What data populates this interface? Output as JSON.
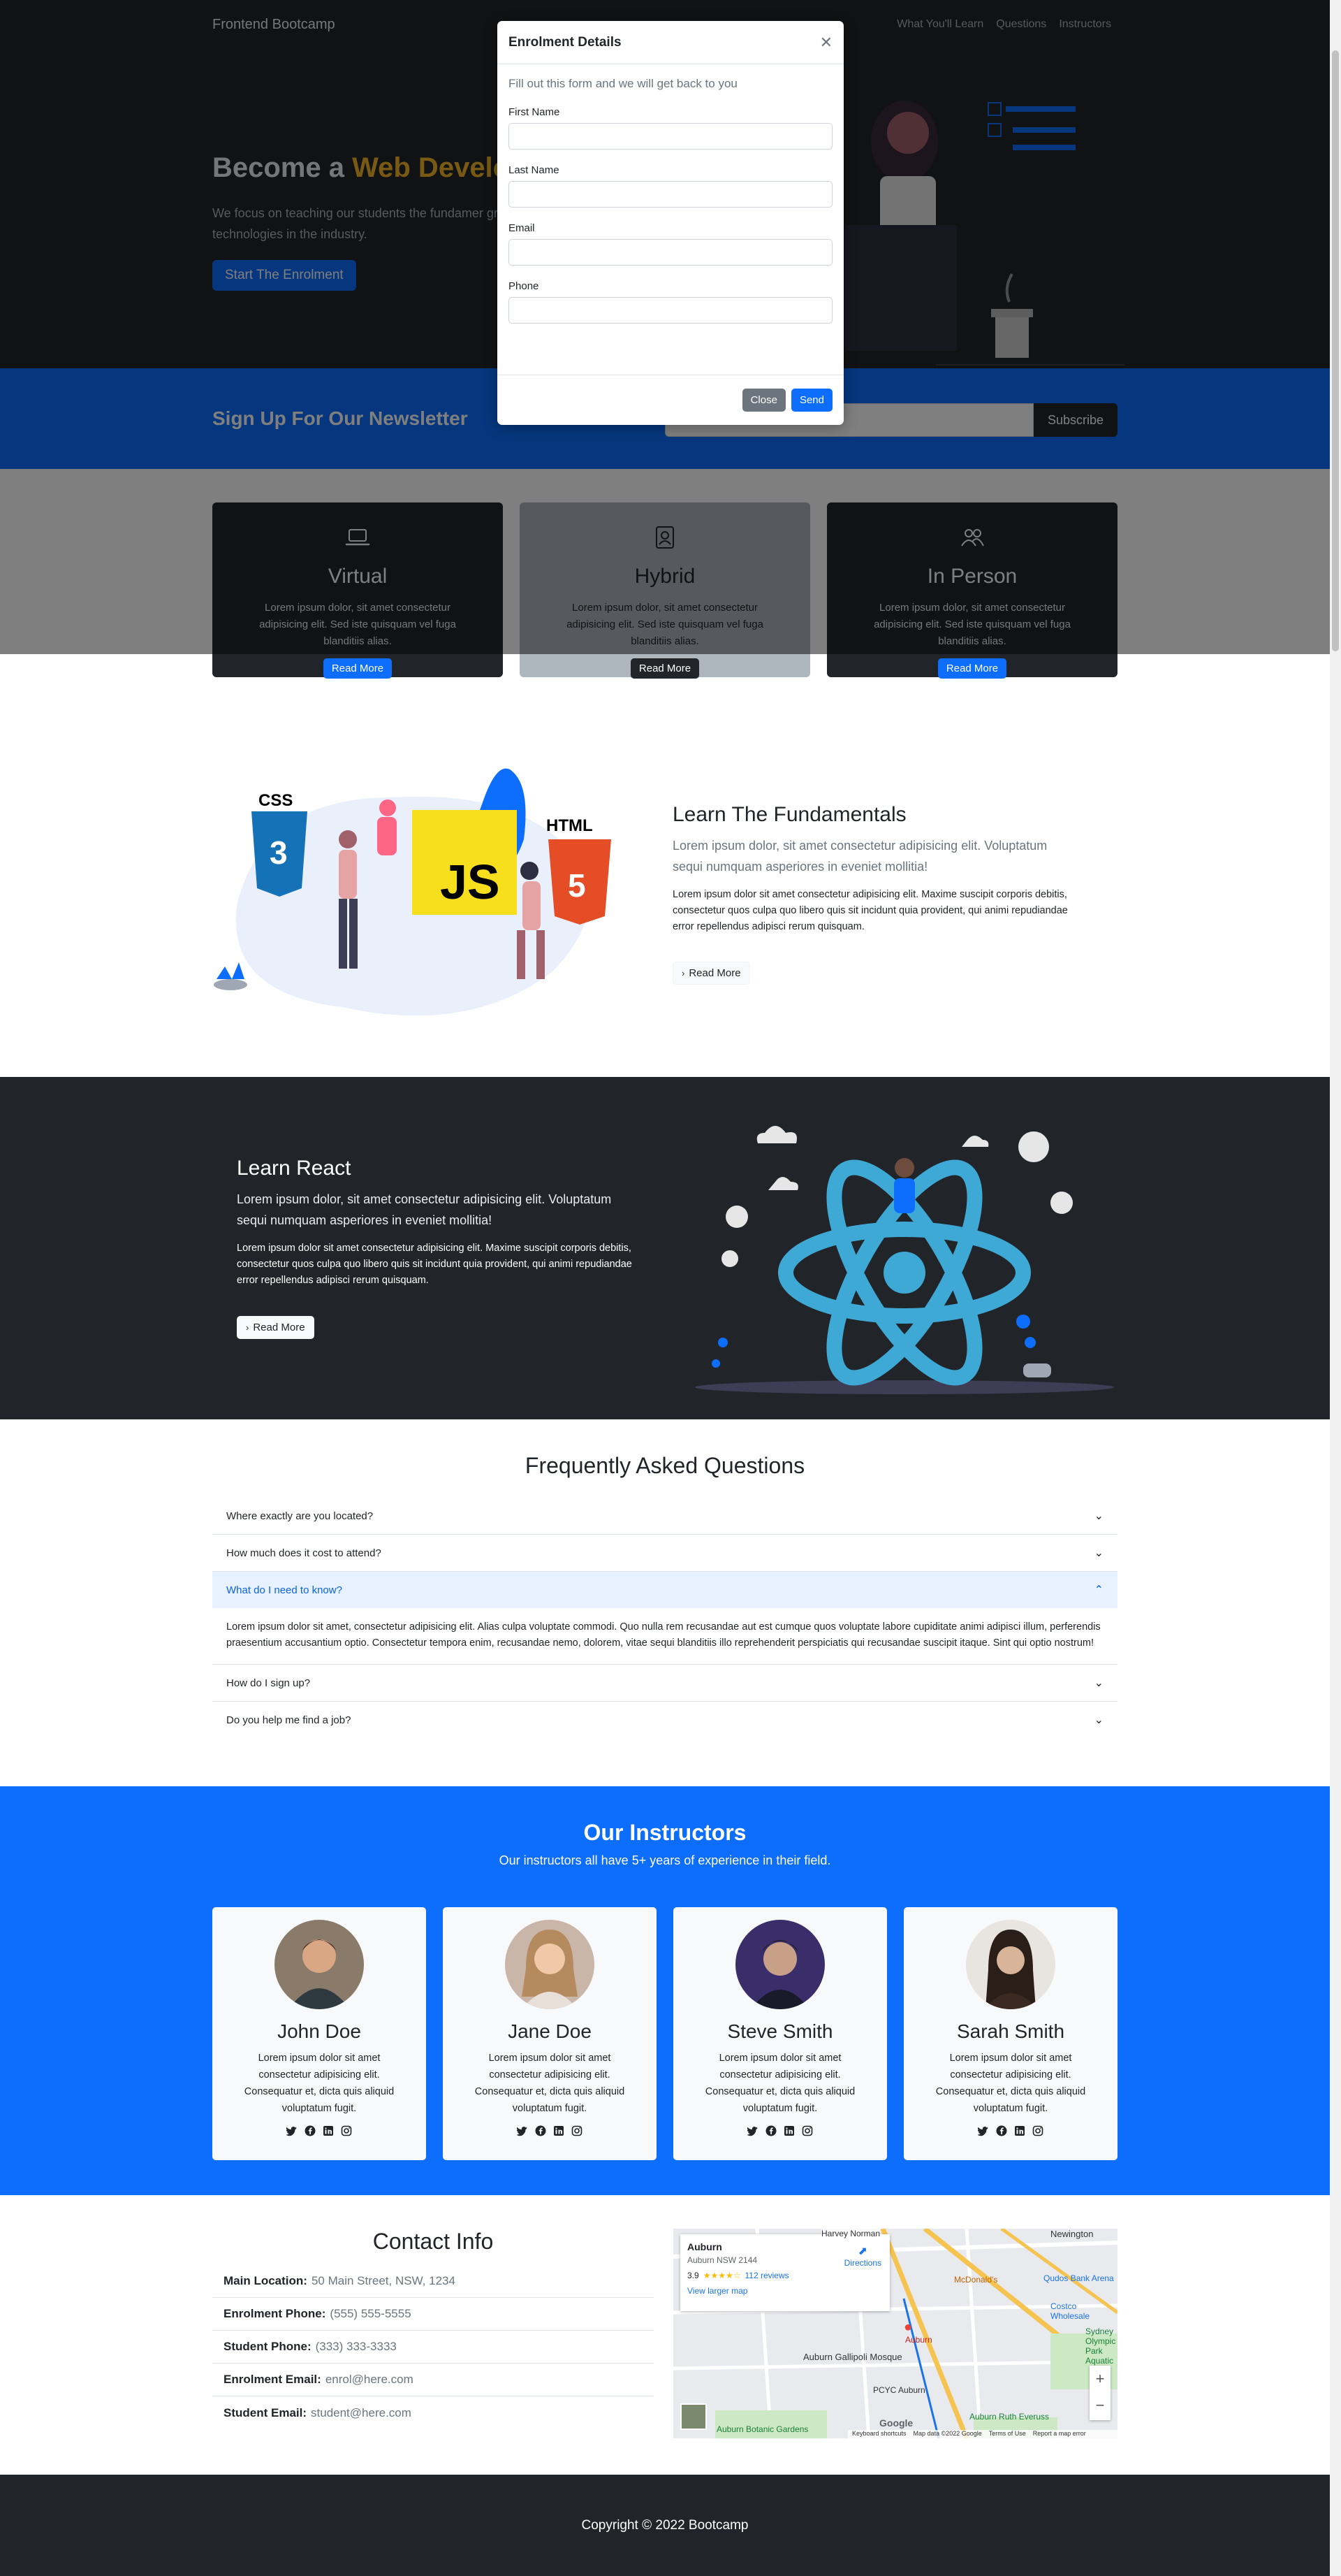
{
  "navbar": {
    "brand": "Frontend Bootcamp",
    "links": [
      "What You'll Learn",
      "Questions",
      "Instructors"
    ]
  },
  "hero": {
    "title_prefix": "Become a ",
    "title_accent": "Web Develo",
    "lead": "We focus on teaching our students the fundamer greatest technologies in the industry.",
    "button": "Start The Enrolment"
  },
  "newsletter": {
    "title": "Sign Up For Our Newsletter",
    "email_placeholder": "",
    "button": "Subscribe"
  },
  "boxes": [
    {
      "icon": "laptop-icon",
      "title": "Virtual",
      "text": "Lorem ipsum dolor, sit amet consectetur adipisicing elit. Sed iste quisquam vel fuga blanditiis alias.",
      "button": "Read More"
    },
    {
      "icon": "person-badge-icon",
      "title": "Hybrid",
      "text": "Lorem ipsum dolor, sit amet consectetur adipisicing elit. Sed iste quisquam vel fuga blanditiis alias.",
      "button": "Read More"
    },
    {
      "icon": "people-icon",
      "title": "In Person",
      "text": "Lorem ipsum dolor, sit amet consectetur adipisicing elit. Sed iste quisquam vel fuga blanditiis alias.",
      "button": "Read More"
    }
  ],
  "learn": {
    "title": "Learn The Fundamentals",
    "lead": "Lorem ipsum dolor, sit amet consectetur adipisicing elit. Voluptatum sequi numquam asperiores in eveniet mollitia!",
    "body": "Lorem ipsum dolor sit amet consectetur adipisicing elit. Maxime suscipit corporis debitis, consectetur quos culpa quo libero quis sit incidunt quia provident, qui animi repudiandae error repellendus adipisci rerum quisquam.",
    "button": "Read More",
    "art_labels": {
      "css": "CSS",
      "js": "JS",
      "html": "HTML"
    }
  },
  "react": {
    "title": "Learn React",
    "lead": "Lorem ipsum dolor, sit amet consectetur adipisicing elit. Voluptatum sequi numquam asperiores in eveniet mollitia!",
    "body": "Lorem ipsum dolor sit amet consectetur adipisicing elit. Maxime suscipit corporis debitis, consectetur quos culpa quo libero quis sit incidunt quia provident, qui animi repudiandae error repellendus adipisci rerum quisquam.",
    "button": "Read More"
  },
  "faq": {
    "title": "Frequently Asked Questions",
    "items": [
      {
        "q": "Where exactly are you located?",
        "open": false
      },
      {
        "q": "How much does it cost to attend?",
        "open": false
      },
      {
        "q": "What do I need to know?",
        "open": true,
        "a": "Lorem ipsum dolor sit amet, consectetur adipisicing elit. Alias culpa voluptate commodi. Quo nulla rem recusandae aut est cumque quos voluptate labore cupiditate animi adipisci illum, perferendis praesentium accusantium optio. Consectetur tempora enim, recusandae nemo, dolorem, vitae sequi blanditiis illo reprehenderit perspiciatis qui recusandae suscipit itaque. Sint qui optio nostrum!"
      },
      {
        "q": "How do I sign up?",
        "open": false
      },
      {
        "q": "Do you help me find a job?",
        "open": false
      }
    ]
  },
  "instructors": {
    "title": "Our Instructors",
    "subtitle": "Our instructors all have 5+ years of experience in their field.",
    "people": [
      {
        "name": "John Doe",
        "bio": "Lorem ipsum dolor sit amet consectetur adipisicing elit. Consequatur et, dicta quis aliquid voluptatum fugit."
      },
      {
        "name": "Jane Doe",
        "bio": "Lorem ipsum dolor sit amet consectetur adipisicing elit. Consequatur et, dicta quis aliquid voluptatum fugit."
      },
      {
        "name": "Steve Smith",
        "bio": "Lorem ipsum dolor sit amet consectetur adipisicing elit. Consequatur et, dicta quis aliquid voluptatum fugit."
      },
      {
        "name": "Sarah Smith",
        "bio": "Lorem ipsum dolor sit amet consectetur adipisicing elit. Consequatur et, dicta quis aliquid voluptatum fugit."
      }
    ]
  },
  "contact": {
    "title": "Contact Info",
    "rows": [
      {
        "label": "Main Location:",
        "value": "50 Main Street, NSW, 1234"
      },
      {
        "label": "Enrolment Phone:",
        "value": "(555) 555-5555"
      },
      {
        "label": "Student Phone:",
        "value": "(333) 333-3333"
      },
      {
        "label": "Enrolment Email:",
        "value": "enrol@here.com"
      },
      {
        "label": "Student Email:",
        "value": "student@here.com"
      }
    ],
    "map": {
      "place": "Auburn",
      "address": "Auburn NSW 2144",
      "rating": "3.9",
      "reviews": "112 reviews",
      "larger_map": "View larger map",
      "directions": "Directions",
      "labels": [
        "Harvey Norman",
        "Newington",
        "McDonald's",
        "Qudos Bank Arena",
        "Costco Wholesale",
        "Sydney Olympic Park Aquatic",
        "Auburn",
        "Auburn Gallipoli Mosque",
        "PCYC Auburn",
        "Auburn Ruth Everuss",
        "Auburn Botanic Gardens"
      ],
      "footer": [
        "Keyboard shortcuts",
        "Map data ©2022 Google",
        "Terms of Use",
        "Report a map error"
      ],
      "google": "Google"
    }
  },
  "footer": {
    "copyright": "Copyright © 2022 Bootcamp"
  },
  "modal": {
    "title": "Enrolment Details",
    "hint": "Fill out this form and we will get back to you",
    "fields": [
      {
        "label": "First Name",
        "value": ""
      },
      {
        "label": "Last Name",
        "value": ""
      },
      {
        "label": "Email",
        "value": ""
      },
      {
        "label": "Phone",
        "value": ""
      }
    ],
    "close": "Close",
    "send": "Send"
  }
}
